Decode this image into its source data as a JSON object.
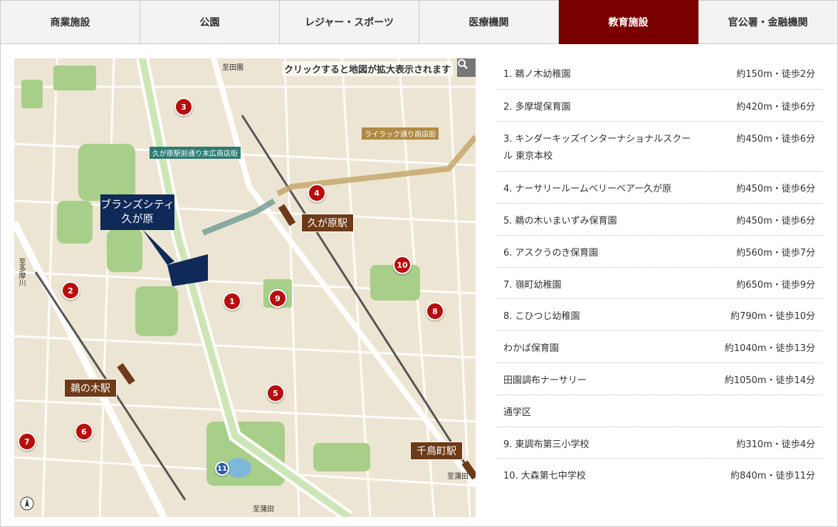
{
  "tabs": [
    {
      "label": "商業施設"
    },
    {
      "label": "公園"
    },
    {
      "label": "レジャー・スポーツ"
    },
    {
      "label": "医療機関"
    },
    {
      "label": "教育施設"
    },
    {
      "label": "官公署・金融機関"
    }
  ],
  "map": {
    "hint": "クリックすると地図が拡大表示されます",
    "property_label": "ブランズシティ\n久が原",
    "stations": {
      "kugahara": "久が原駅",
      "unoki": "鵜の木駅",
      "chidoricho": "千鳥町駅"
    },
    "streets": {
      "lilac": "ライラック通り商店街",
      "kugahara_mae": "久が原駅前通り末広商店街"
    },
    "roads": {
      "setagaya": "至田園",
      "tamagawa": "至多摩川",
      "kamata1": "至蒲田",
      "kamata2": "至蒲田",
      "tamagawa_river": "多摩川堤通り"
    },
    "markers": [
      "3",
      "4",
      "2",
      "1",
      "9",
      "10",
      "8",
      "5",
      "6",
      "7",
      "11"
    ]
  },
  "facilities": [
    {
      "name": "1. 鵜ノ木幼稚園",
      "distance": "約150m・徒歩2分"
    },
    {
      "name": "2. 多摩堤保育園",
      "distance": "約420m・徒歩6分"
    },
    {
      "name": "3. キンダーキッズインターナショナルスクール 東京本校",
      "distance": "約450m・徒歩6分"
    },
    {
      "name": "4. ナーサリールームベリーベアー久が原",
      "distance": "約450m・徒歩6分"
    },
    {
      "name": "5. 鵜の木いまいずみ保育園",
      "distance": "約450m・徒歩6分"
    },
    {
      "name": "6. アスクうのき保育園",
      "distance": "約560m・徒歩7分"
    },
    {
      "name": "7. 嶺町幼稚園",
      "distance": "約650m・徒歩9分"
    },
    {
      "name": "8. こひつじ幼稚園",
      "distance": "約790m・徒歩10分"
    },
    {
      "name": "わかば保育園",
      "distance": "約1040m・徒歩13分"
    },
    {
      "name": "田園調布ナーサリー",
      "distance": "約1050m・徒歩14分"
    },
    {
      "name": "通学区",
      "distance": ""
    },
    {
      "name": "9. 東調布第三小学校",
      "distance": "約310m・徒歩4分"
    },
    {
      "name": "10. 大森第七中学校",
      "distance": "約840m・徒歩11分"
    }
  ],
  "colors": {
    "active_tab": "#7a0000",
    "marker": "#b80d0d",
    "property": "#0f2a58",
    "station": "#6e3a17"
  }
}
